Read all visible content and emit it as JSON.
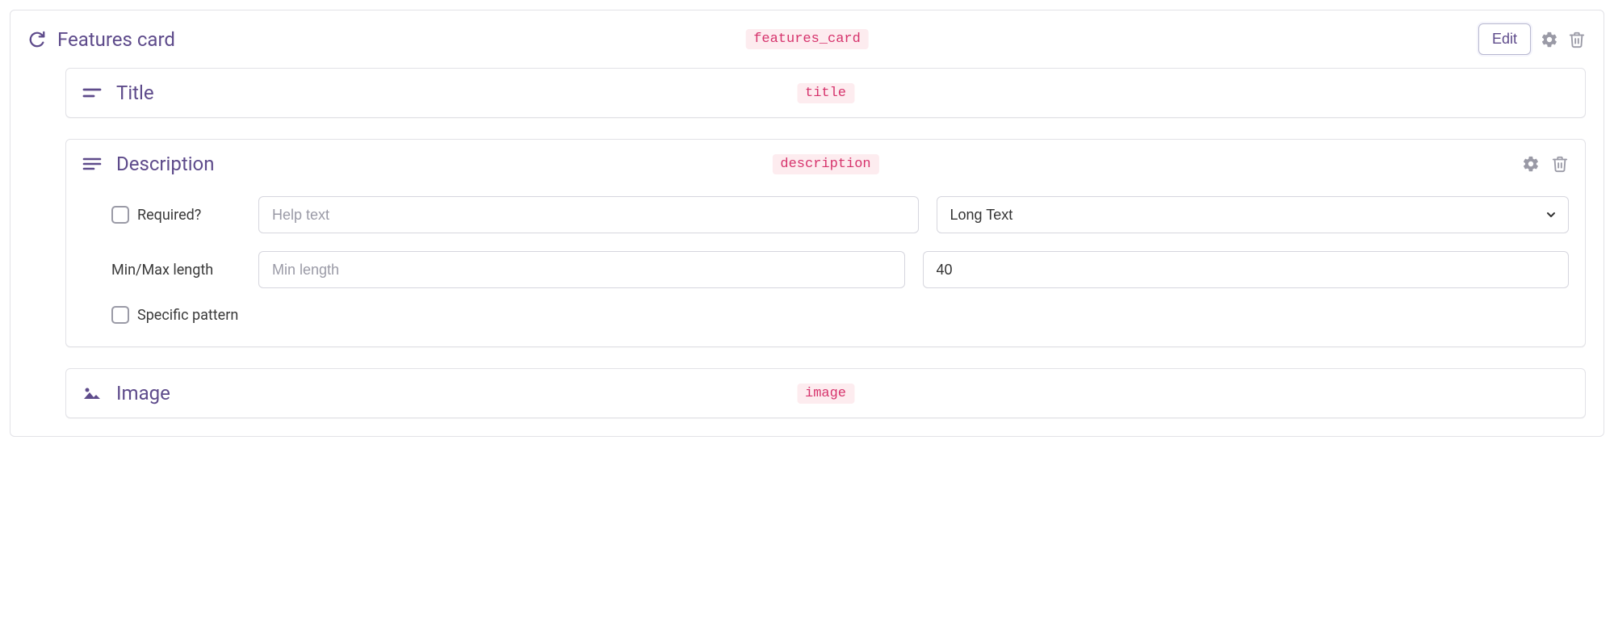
{
  "card": {
    "title": "Features card",
    "code": "features_card",
    "edit_label": "Edit"
  },
  "fields": {
    "title": {
      "label": "Title",
      "code": "title"
    },
    "description": {
      "label": "Description",
      "code": "description",
      "required_label": "Required?",
      "help_text_placeholder": "Help text",
      "type_selected": "Long Text",
      "minmax_label": "Min/Max length",
      "min_placeholder": "Min length",
      "max_value": "40",
      "specific_pattern_label": "Specific pattern"
    },
    "image": {
      "label": "Image",
      "code": "image"
    }
  }
}
